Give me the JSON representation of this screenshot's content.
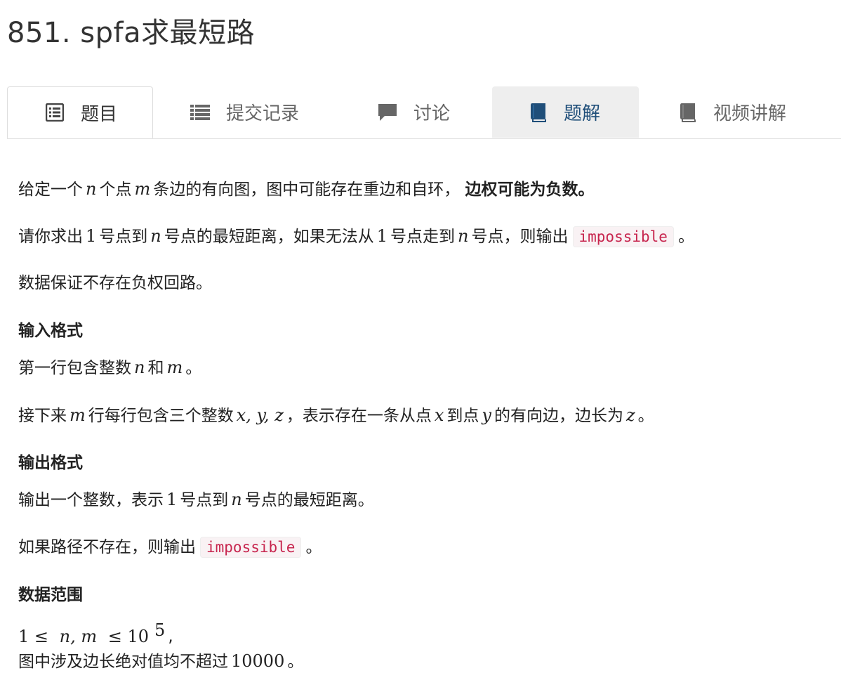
{
  "page_title": "851. spfa求最短路",
  "tabs": [
    {
      "label": "题目",
      "icon": "list-alt-icon"
    },
    {
      "label": "提交记录",
      "icon": "list-icon"
    },
    {
      "label": "讨论",
      "icon": "comment-icon"
    },
    {
      "label": "题解",
      "icon": "book-icon"
    },
    {
      "label": "视频讲解",
      "icon": "book-icon"
    }
  ],
  "problem": {
    "p1": {
      "a": "给定一个",
      "n": "n",
      "b": "个点",
      "m": "m",
      "c": "条边的有向图，图中可能存在重边和自环，",
      "bold": "边权可能为负数。"
    },
    "p2": {
      "a": "请你求出",
      "one": "1",
      "b": "号点到",
      "n": "n",
      "c": "号点的最短距离，如果无法从",
      "one2": "1",
      "d": "号点走到",
      "n2": "n",
      "e": "号点，则输出",
      "code": "impossible",
      "f": "。"
    },
    "p3": "数据保证不存在负权回路。",
    "input_heading": "输入格式",
    "p4": {
      "a": "第一行包含整数",
      "n": "n",
      "b": "和",
      "m": "m",
      "c": "。"
    },
    "p5": {
      "a": "接下来",
      "m": "m",
      "b": "行每行包含三个整数",
      "xyz": "x, y, z",
      "c": "，表示存在一条从点",
      "x": "x",
      "d": "到点",
      "y": "y",
      "e": "的有向边，边长为",
      "z": "z",
      "f": "。"
    },
    "output_heading": "输出格式",
    "p6": {
      "a": "输出一个整数，表示",
      "one": "1",
      "b": "号点到",
      "n": "n",
      "c": "号点的最短距离。"
    },
    "p7": {
      "a": "如果路径不存在，则输出",
      "code": "impossible",
      "b": "。"
    },
    "range_heading": "数据范围",
    "p8": {
      "a": "1 ≤ ",
      "nm": "n, m",
      "b": " ≤ 10",
      "exp": "5",
      "c": ","
    },
    "p9": {
      "a": "图中涉及边长绝对值均不超过",
      "num": "10000",
      "b": "。"
    }
  }
}
